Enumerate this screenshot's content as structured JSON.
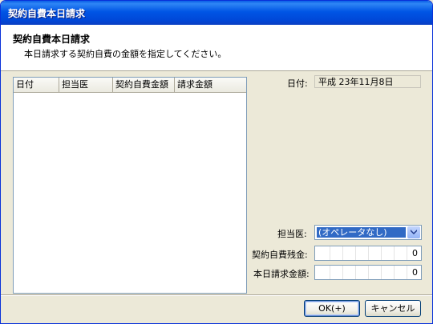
{
  "window": {
    "title": "契約自費本日請求"
  },
  "header": {
    "title": "契約自費本日請求",
    "description": "本日請求する契約自費の金額を指定してください。"
  },
  "list": {
    "columns": [
      "日付",
      "担当医",
      "契約自費金額",
      "請求金額"
    ],
    "rows": []
  },
  "form": {
    "date_label": "日付:",
    "date_value": "平成 23年11月8日",
    "doctor_label": "担当医:",
    "doctor_value": "(オペレータなし)",
    "balance_label": "契約自費残金:",
    "balance_value": "0",
    "charge_label": "本日請求金額:",
    "charge_value": "0"
  },
  "buttons": {
    "ok": "OK(+)",
    "cancel": "キャンセル"
  }
}
